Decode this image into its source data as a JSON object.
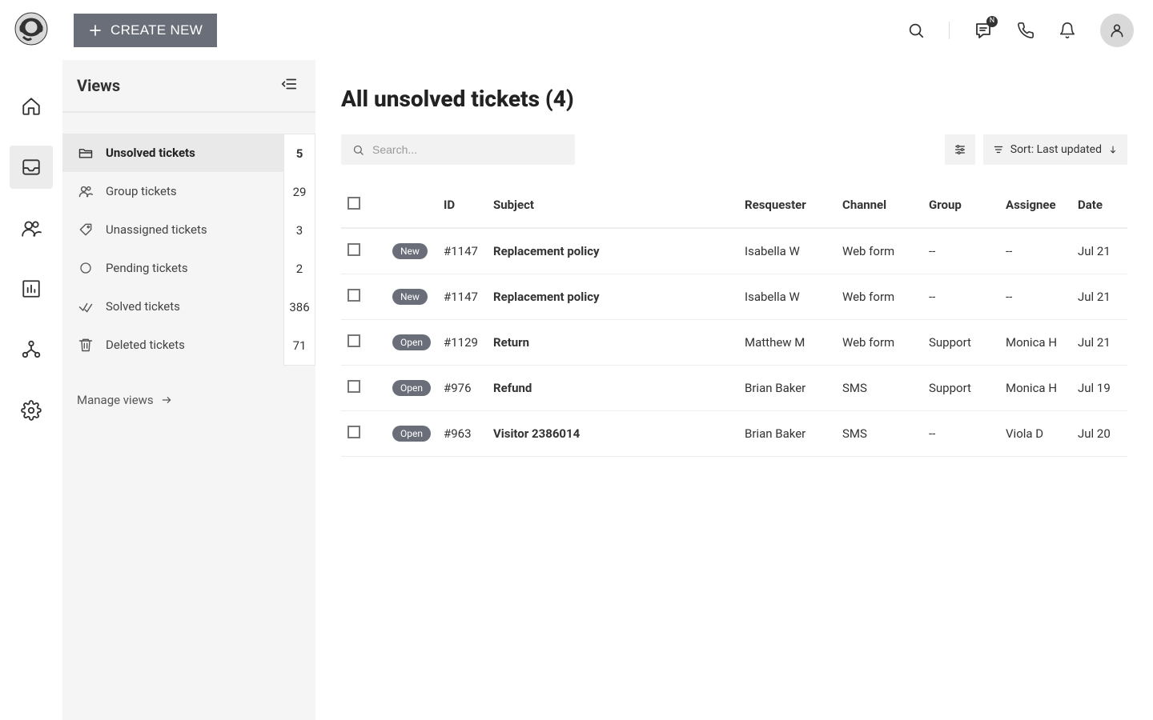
{
  "header": {
    "create_label": "CREATE NEW",
    "chat_badge": "N"
  },
  "views_panel": {
    "title": "Views",
    "manage_label": "Manage views",
    "items": [
      {
        "label": "Unsolved tickets",
        "count": "5",
        "active": true
      },
      {
        "label": "Group tickets",
        "count": "29",
        "active": false
      },
      {
        "label": "Unassigned tickets",
        "count": "3",
        "active": false
      },
      {
        "label": "Pending tickets",
        "count": "2",
        "active": false
      },
      {
        "label": "Solved tickets",
        "count": "386",
        "active": false
      },
      {
        "label": "Deleted tickets",
        "count": "71",
        "active": false
      }
    ]
  },
  "main": {
    "title": "All unsolved tickets (4)",
    "search_placeholder": "Search...",
    "sort_label": "Sort: Last updated",
    "columns": {
      "id": "ID",
      "subject": "Subject",
      "requester": "Resquester",
      "channel": "Channel",
      "group": "Group",
      "assignee": "Assignee",
      "date": "Date"
    },
    "rows": [
      {
        "status": "New",
        "id": "#1147",
        "subject": "Replacement policy",
        "requester": "Isabella W",
        "channel": "Web form",
        "group": "--",
        "assignee": "--",
        "date": "Jul 21"
      },
      {
        "status": "New",
        "id": "#1147",
        "subject": "Replacement policy",
        "requester": "Isabella W",
        "channel": "Web form",
        "group": "--",
        "assignee": "--",
        "date": "Jul 21"
      },
      {
        "status": "Open",
        "id": "#1129",
        "subject": "Return",
        "requester": "Matthew M",
        "channel": "Web form",
        "group": "Support",
        "assignee": "Monica H",
        "date": "Jul 21"
      },
      {
        "status": "Open",
        "id": "#976",
        "subject": "Refund",
        "requester": "Brian Baker",
        "channel": "SMS",
        "group": "Support",
        "assignee": "Monica H",
        "date": "Jul 19"
      },
      {
        "status": "Open",
        "id": "#963",
        "subject": "Visitor 2386014",
        "requester": "Brian Baker",
        "channel": "SMS",
        "group": "--",
        "assignee": "Viola D",
        "date": "Jul 20"
      }
    ]
  }
}
